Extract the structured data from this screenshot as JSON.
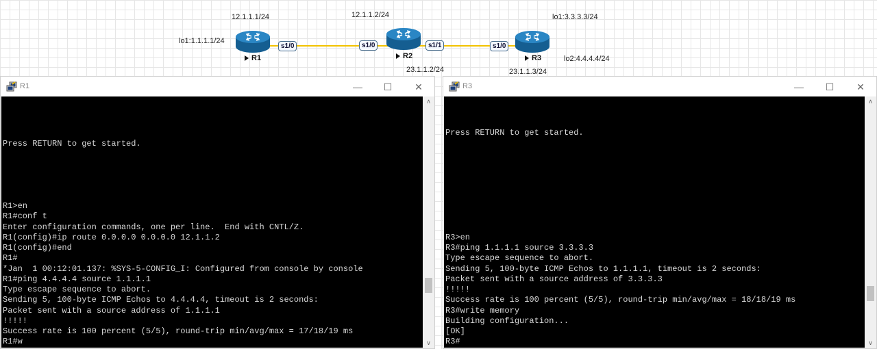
{
  "topology": {
    "labels": {
      "r1_s10_ip": "12.1.1.1/24",
      "r2_s10_ip": "12.1.1.2/24",
      "r3_lo1": "lo1:3.3.3.3/24",
      "r1_lo1": "lo1:1.1.1.1/24",
      "r3_lo2": "lo2:4.4.4.4/24",
      "r2_s11_ip": "23.1.1.2/24",
      "r3_s10_ip": "23.1.1.3/24"
    },
    "routers": {
      "r1": "R1",
      "r2": "R2",
      "r3": "R3"
    },
    "ports": {
      "r1_s10": "s1/0",
      "r2_s10": "s1/0",
      "r2_s11": "s1/1",
      "r3_s10": "s1/0"
    },
    "colors": {
      "link": "#f2c200",
      "router_body": "#1b6fa8"
    }
  },
  "windows": {
    "r1": {
      "title": "R1",
      "controls": {
        "minimize": "—",
        "maximize": "☐",
        "close": "✕"
      },
      "lines": [
        "Press RETURN to get started.",
        "R1>en",
        "R1#conf t",
        "Enter configuration commands, one per line.  End with CNTL/Z.",
        "R1(config)#ip route 0.0.0.0 0.0.0.0 12.1.1.2",
        "R1(config)#end",
        "R1#",
        "*Jan  1 00:12:01.137: %SYS-5-CONFIG_I: Configured from console by console",
        "R1#ping 4.4.4.4 source 1.1.1.1",
        "Type escape sequence to abort.",
        "Sending 5, 100-byte ICMP Echos to 4.4.4.4, timeout is 2 seconds:",
        "Packet sent with a source address of 1.1.1.1",
        "!!!!!",
        "Success rate is 100 percent (5/5), round-trip min/avg/max = 17/18/19 ms",
        "R1#w"
      ]
    },
    "r3": {
      "title": "R3",
      "controls": {
        "minimize": "—",
        "maximize": "☐",
        "close": "✕"
      },
      "lines": [
        "Press RETURN to get started.",
        "R3>en",
        "R3#ping 1.1.1.1 source 3.3.3.3",
        "Type escape sequence to abort.",
        "Sending 5, 100-byte ICMP Echos to 1.1.1.1, timeout is 2 seconds:",
        "Packet sent with a source address of 3.3.3.3",
        "!!!!!",
        "Success rate is 100 percent (5/5), round-trip min/avg/max = 18/18/19 ms",
        "R3#write memory",
        "Building configuration...",
        "[OK]",
        "R3#"
      ]
    }
  }
}
